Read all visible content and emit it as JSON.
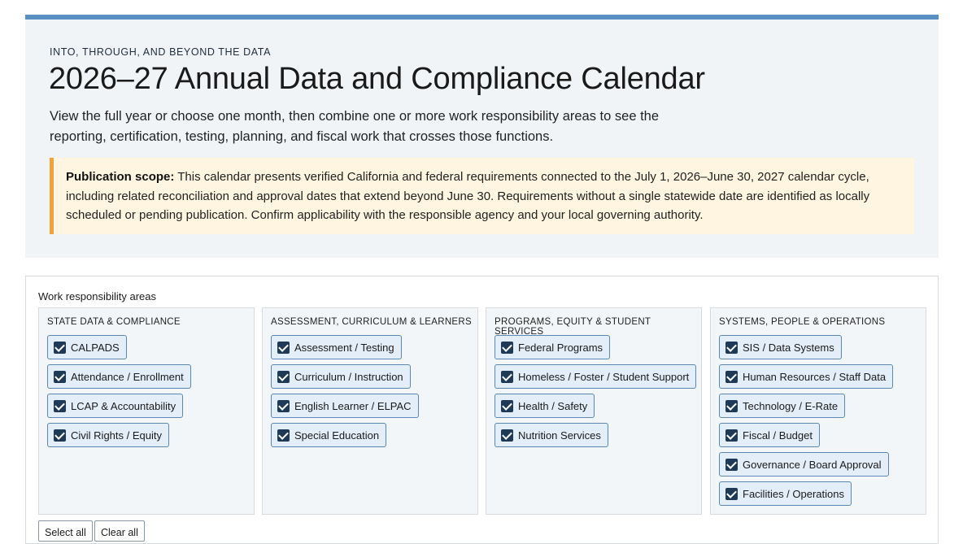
{
  "hero": {
    "eyebrow": "INTO, THROUGH, AND BEYOND THE DATA",
    "title": "2026–27 Annual Data and Compliance Calendar",
    "intro": "View the full year or choose one month, then combine one or more work responsibility areas to see the reporting, certification, testing, planning, and fiscal work that crosses those functions.",
    "scope_label": "Publication scope:",
    "scope_text": " This calendar presents verified California and federal requirements connected to the July 1, 2026–June 30, 2027 calendar cycle, including related reconciliation and approval dates that extend beyond June 30. Requirements without a single statewide date are identified as locally scheduled or pending publication. Confirm applicability with the responsible agency and your local governing authority.",
    "accent_color": "#5a8fc4",
    "scope_accent_color": "#f0a23a"
  },
  "filters": {
    "label": "Work responsibility areas",
    "groups": [
      {
        "title": "STATE DATA & COMPLIANCE",
        "items": [
          {
            "label": "CALPADS",
            "checked": true
          },
          {
            "label": "Attendance / Enrollment",
            "checked": true
          },
          {
            "label": "LCAP & Accountability",
            "checked": true
          },
          {
            "label": "Civil Rights / Equity",
            "checked": true
          }
        ]
      },
      {
        "title": "ASSESSMENT, CURRICULUM & LEARNERS",
        "items": [
          {
            "label": "Assessment / Testing",
            "checked": true
          },
          {
            "label": "Curriculum / Instruction",
            "checked": true
          },
          {
            "label": "English Learner / ELPAC",
            "checked": true
          },
          {
            "label": "Special Education",
            "checked": true
          }
        ]
      },
      {
        "title": "PROGRAMS, EQUITY & STUDENT SERVICES",
        "items": [
          {
            "label": "Federal Programs",
            "checked": true
          },
          {
            "label": "Homeless / Foster / Student Support",
            "checked": true
          },
          {
            "label": "Health / Safety",
            "checked": true
          },
          {
            "label": "Nutrition Services",
            "checked": true
          }
        ]
      },
      {
        "title": "SYSTEMS, PEOPLE & OPERATIONS",
        "items": [
          {
            "label": "SIS / Data Systems",
            "checked": true
          },
          {
            "label": "Human Resources / Staff Data",
            "checked": true
          },
          {
            "label": "Technology / E-Rate",
            "checked": true
          },
          {
            "label": "Fiscal / Budget",
            "checked": true
          },
          {
            "label": "Governance / Board Approval",
            "checked": true
          },
          {
            "label": "Facilities / Operations",
            "checked": true
          }
        ]
      }
    ],
    "select_all_label": "Select all",
    "clear_all_label": "Clear all"
  }
}
